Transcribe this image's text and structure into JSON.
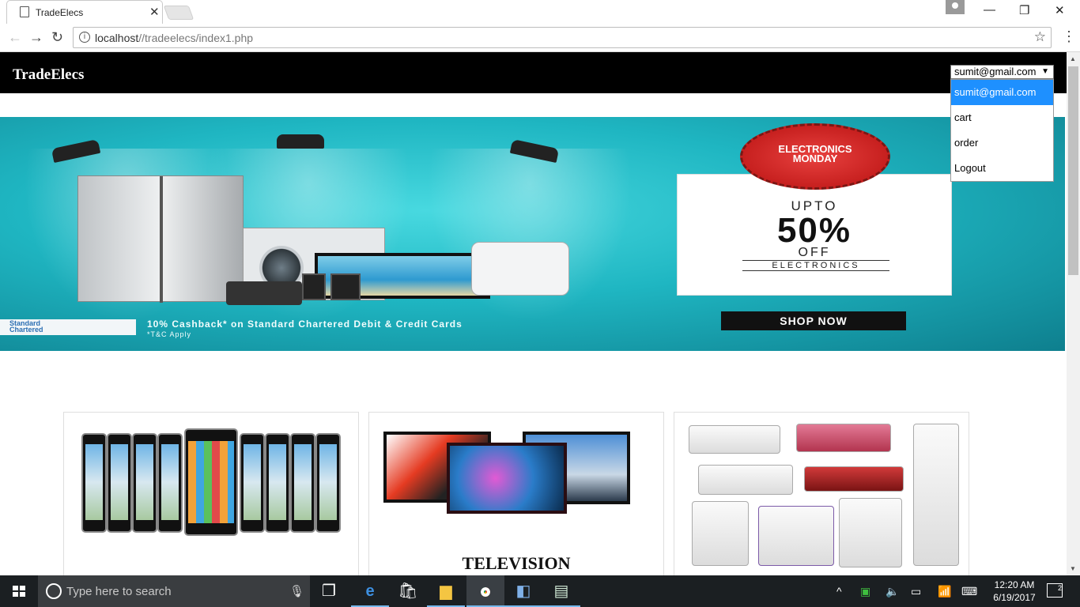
{
  "browser": {
    "tab_title": "TradeElecs",
    "url_host": "localhost",
    "url_path": "//tradeelecs/index1.php",
    "icons": {
      "tab": "page-icon",
      "close": "close-icon",
      "back": "back-arrow-icon",
      "forward": "forward-arrow-icon",
      "reload": "reload-icon",
      "info": "info-icon",
      "bookmark": "star-icon",
      "menu": "vertical-dots-icon"
    }
  },
  "site": {
    "brand": "TradeElecs",
    "account": {
      "selected": "sumit@gmail.com",
      "options": [
        "sumit@gmail.com",
        "cart",
        "order",
        "Logout"
      ]
    }
  },
  "banner": {
    "badge_line1": "ELECTRONICS",
    "badge_line2": "MONDAY",
    "upto": "UPTO",
    "percent": "50%",
    "off": "OFF",
    "category": "ELECTRONICS",
    "cta": "SHOP NOW",
    "bank_line1": "Standard",
    "bank_line2": "Chartered",
    "cashback": "10% Cashback* on Standard Chartered Debit & Credit Cards",
    "terms": "*T&C Apply"
  },
  "cards": [
    {
      "title": ""
    },
    {
      "title": "TELEVISION"
    },
    {
      "title": ""
    }
  ],
  "taskbar": {
    "search_placeholder": "Type here to search",
    "time": "12:20 AM",
    "date": "6/19/2017",
    "notification_count": "2"
  },
  "colors": {
    "site_header": "#000000",
    "dropdown_selected": "#1e90ff",
    "banner_teal": "#1fb6c2",
    "taskbar": "#1b1f22"
  }
}
